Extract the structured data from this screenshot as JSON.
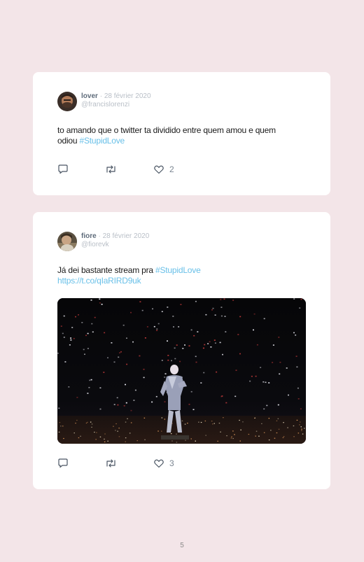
{
  "tweets": [
    {
      "author": "lover",
      "date": "28 février 2020",
      "handle": "@francislorenzi",
      "text": "to amando que o twitter ta dividido entre quem amou e quem odiou ",
      "hashtag": "#StupidLove",
      "likes": "2"
    },
    {
      "author": "fiore",
      "date": "28 février 2020",
      "handle": "@fiorevk",
      "text": "Já dei bastante stream pra ",
      "hashtag": "#StupidLove",
      "link": "https://t.co/qIaRIRD9uk",
      "likes": "3"
    }
  ],
  "separator": "·",
  "icons": [
    "reply-icon",
    "retweet-icon",
    "heart-icon"
  ],
  "colors": {
    "background": "#f3e5e8",
    "card": "#ffffff",
    "accent": "#69c0e8"
  },
  "page_number": "5"
}
